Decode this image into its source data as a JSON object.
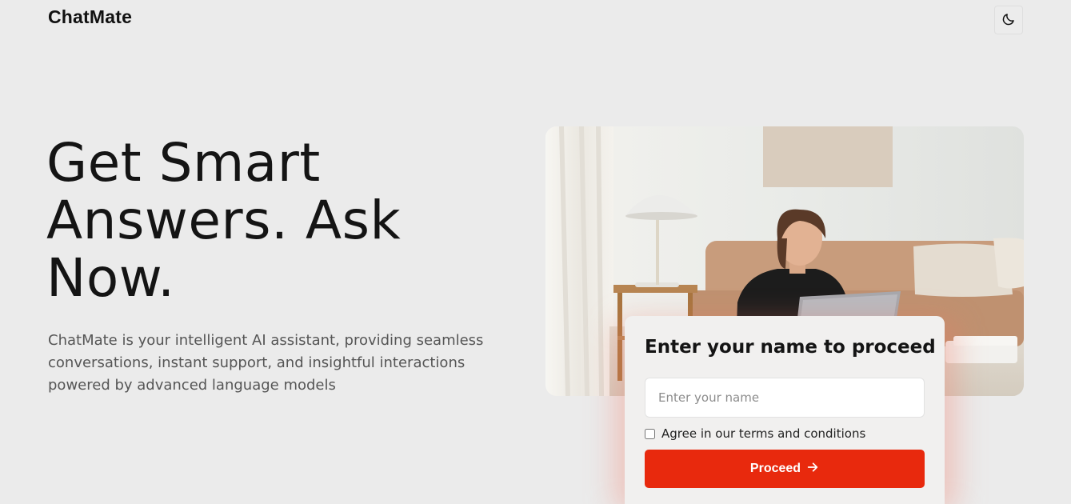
{
  "header": {
    "brand": "ChatMate",
    "theme_toggle_icon": "moon-icon"
  },
  "hero": {
    "title": "Get Smart Answers. Ask Now.",
    "description": "ChatMate is your intelligent AI assistant, providing seamless conversations, instant support, and insightful interactions powered by advanced language models"
  },
  "form": {
    "title": "Enter your name to proceed",
    "name_placeholder": "Enter your name",
    "name_value": "",
    "agree_label": "Agree in our terms and conditions",
    "agree_checked": false,
    "proceed_label": "Proceed",
    "proceed_icon": "arrow-right-icon"
  },
  "colors": {
    "background": "#ebebeb",
    "accent": "#e8290d",
    "card": "#f1f0ef"
  }
}
